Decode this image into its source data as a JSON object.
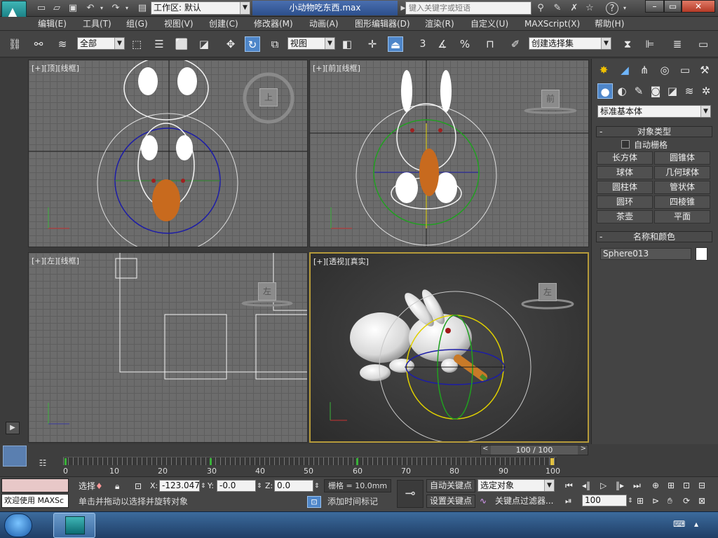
{
  "window": {
    "file_title": "小动物吃东西.max",
    "workspace_label": "工作区: 默认",
    "search_placeholder": "键入关键字或短语"
  },
  "menus": [
    "编辑(E)",
    "工具(T)",
    "组(G)",
    "视图(V)",
    "创建(C)",
    "修改器(M)",
    "动画(A)",
    "图形编辑器(D)",
    "渲染(R)",
    "自定义(U)",
    "MAXScript(X)",
    "帮助(H)"
  ],
  "toolbar": {
    "filter_value": "全部",
    "ref_coord_value": "视图",
    "named_selection_placeholder": "创建选择集",
    "snap_3_label": "3",
    "percent_label": "%"
  },
  "viewports": {
    "top": {
      "label": "[+][顶][线框]",
      "cube_face": "上"
    },
    "front": {
      "label": "[+][前][线框]",
      "cube_face": "前"
    },
    "left": {
      "label": "[+][左][线框]",
      "cube_face": "左"
    },
    "perspective": {
      "label": "[+][透视][真实]",
      "cube_face": "左"
    }
  },
  "command_panel": {
    "category_dropdown": "标准基本体",
    "object_type_title": "对象类型",
    "auto_grid_label": "自动栅格",
    "buttons": [
      "长方体",
      "圆锥体",
      "球体",
      "几何球体",
      "圆柱体",
      "管状体",
      "圆环",
      "四棱锥",
      "茶壶",
      "平面"
    ],
    "name_color_title": "名称和颜色",
    "object_name": "Sphere013",
    "collapse_mark": "-"
  },
  "timeline": {
    "frame_display": "100 / 100",
    "ticks": [
      "0",
      "10",
      "20",
      "30",
      "40",
      "50",
      "60",
      "70",
      "80",
      "90",
      "100"
    ]
  },
  "status": {
    "maxscript_label": "欢迎使用 MAXSc",
    "select_label": "选择",
    "x_label": "X:",
    "x_value": "-123.047",
    "y_label": "Y:",
    "y_value": "-0.0",
    "z_label": "Z:",
    "z_value": "0.0",
    "grid_text": "栅格 = 10.0mm",
    "prompt_text": "单击并拖动以选择并旋转对象",
    "add_time_tag": "添加时间标记",
    "auto_key": "自动关键点",
    "set_key": "设置关键点",
    "selected_object": "选定对象",
    "key_filter": "关键点过滤器...",
    "frame_value": "100"
  }
}
